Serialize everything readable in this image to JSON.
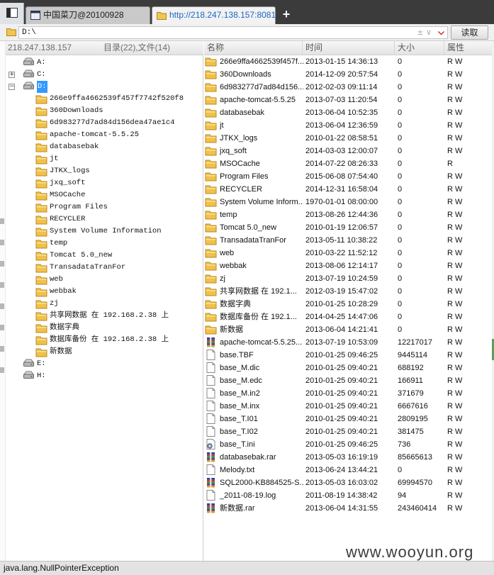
{
  "tabs": [
    {
      "title": "中国菜刀@20100928",
      "active": false
    },
    {
      "title": "http://218.247.138.157:8081...",
      "active": true
    }
  ],
  "newtab_symbol": "+",
  "path": {
    "value": "D:\\",
    "plusminus": "± ∨",
    "read_label": "读取"
  },
  "left": {
    "ip": "218.247.138.157",
    "counts": "目录(22),文件(14)",
    "drives_top": [
      {
        "label": "A:",
        "toggle": ""
      },
      {
        "label": "C:",
        "toggle": "+"
      },
      {
        "label": "D:",
        "toggle": "−",
        "selected": true
      }
    ],
    "tree_dirs": [
      "266e9ffa4662539f457f7742f520f8",
      "360Downloads",
      "6d983277d7ad84d156dea47ae1c4",
      "apache-tomcat-5.5.25",
      "databasebak",
      "jt",
      "JTKX_logs",
      "jxq_soft",
      "MSOCache",
      "Program Files",
      "RECYCLER",
      "System Volume Information",
      "temp",
      "Tomcat 5.0_new",
      "TransadataTranFor",
      "web",
      "webbak",
      "zj",
      "共享网数据 在 192.168.2.38 上",
      "数据字典",
      "数据库备份 在 192.168.2.38 上",
      "新数据"
    ],
    "drives_bottom": [
      {
        "label": "E:"
      },
      {
        "label": "H:"
      }
    ]
  },
  "list": {
    "headers": {
      "name": "名称",
      "time": "时间",
      "size": "大小",
      "attr": "属性"
    },
    "rows": [
      {
        "name": "266e9ffa4662539f457f...",
        "time": "2013-01-15 14:36:13",
        "size": "0",
        "attr": "R W",
        "icon": "folder-icon"
      },
      {
        "name": "360Downloads",
        "time": "2014-12-09 20:57:54",
        "size": "0",
        "attr": "R W",
        "icon": "folder-icon"
      },
      {
        "name": "6d983277d7ad84d156...",
        "time": "2012-02-03 09:11:14",
        "size": "0",
        "attr": "R W",
        "icon": "folder-icon"
      },
      {
        "name": "apache-tomcat-5.5.25",
        "time": "2013-07-03 11:20:54",
        "size": "0",
        "attr": "R W",
        "icon": "folder-icon"
      },
      {
        "name": "databasebak",
        "time": "2013-06-04 10:52:35",
        "size": "0",
        "attr": "R W",
        "icon": "folder-icon"
      },
      {
        "name": "jt",
        "time": "2013-06-04 12:36:59",
        "size": "0",
        "attr": "R W",
        "icon": "folder-icon"
      },
      {
        "name": "JTKX_logs",
        "time": "2010-01-22 08:58:51",
        "size": "0",
        "attr": "R W",
        "icon": "folder-icon"
      },
      {
        "name": "jxq_soft",
        "time": "2014-03-03 12:00:07",
        "size": "0",
        "attr": "R W",
        "icon": "folder-icon"
      },
      {
        "name": "MSOCache",
        "time": "2014-07-22 08:26:33",
        "size": "0",
        "attr": "R",
        "icon": "folder-icon"
      },
      {
        "name": "Program Files",
        "time": "2015-06-08 07:54:40",
        "size": "0",
        "attr": "R W",
        "icon": "folder-icon"
      },
      {
        "name": "RECYCLER",
        "time": "2014-12-31 16:58:04",
        "size": "0",
        "attr": "R W",
        "icon": "folder-icon"
      },
      {
        "name": "System Volume Inform...",
        "time": "1970-01-01 08:00:00",
        "size": "0",
        "attr": "R W",
        "icon": "folder-icon"
      },
      {
        "name": "temp",
        "time": "2013-08-26 12:44:36",
        "size": "0",
        "attr": "R W",
        "icon": "folder-icon"
      },
      {
        "name": "Tomcat 5.0_new",
        "time": "2010-01-19 12:06:57",
        "size": "0",
        "attr": "R W",
        "icon": "folder-icon"
      },
      {
        "name": "TransadataTranFor",
        "time": "2013-05-11 10:38:22",
        "size": "0",
        "attr": "R W",
        "icon": "folder-icon"
      },
      {
        "name": "web",
        "time": "2010-03-22 11:52:12",
        "size": "0",
        "attr": "R W",
        "icon": "folder-icon"
      },
      {
        "name": "webbak",
        "time": "2013-08-06 12:14:17",
        "size": "0",
        "attr": "R W",
        "icon": "folder-icon"
      },
      {
        "name": "zj",
        "time": "2013-07-19 10:24:59",
        "size": "0",
        "attr": "R W",
        "icon": "folder-icon"
      },
      {
        "name": "共享网数据 在 192.1...",
        "time": "2012-03-19 15:47:02",
        "size": "0",
        "attr": "R W",
        "icon": "folder-icon"
      },
      {
        "name": "数据字典",
        "time": "2010-01-25 10:28:29",
        "size": "0",
        "attr": "R W",
        "icon": "folder-icon"
      },
      {
        "name": "数据库备份 在 192.1...",
        "time": "2014-04-25 14:47:06",
        "size": "0",
        "attr": "R W",
        "icon": "folder-icon"
      },
      {
        "name": "新数据",
        "time": "2013-06-04 14:21:41",
        "size": "0",
        "attr": "R W",
        "icon": "folder-icon"
      },
      {
        "name": "apache-tomcat-5.5.25...",
        "time": "2013-07-19 10:53:09",
        "size": "12217017",
        "attr": "R W",
        "icon": "archive-icon"
      },
      {
        "name": "base.TBF",
        "time": "2010-01-25 09:46:25",
        "size": "9445114",
        "attr": "R W",
        "icon": "file-icon"
      },
      {
        "name": "base_M.dic",
        "time": "2010-01-25 09:40:21",
        "size": "688192",
        "attr": "R W",
        "icon": "file-icon"
      },
      {
        "name": "base_M.edc",
        "time": "2010-01-25 09:40:21",
        "size": "166911",
        "attr": "R W",
        "icon": "file-icon"
      },
      {
        "name": "base_M.in2",
        "time": "2010-01-25 09:40:21",
        "size": "371679",
        "attr": "R W",
        "icon": "file-icon"
      },
      {
        "name": "base_M.inx",
        "time": "2010-01-25 09:40:21",
        "size": "6667616",
        "attr": "R W",
        "icon": "file-icon"
      },
      {
        "name": "base_T.I01",
        "time": "2010-01-25 09:40:21",
        "size": "2809195",
        "attr": "R W",
        "icon": "file-icon"
      },
      {
        "name": "base_T.I02",
        "time": "2010-01-25 09:40:21",
        "size": "381475",
        "attr": "R W",
        "icon": "file-icon"
      },
      {
        "name": "base_T.ini",
        "time": "2010-01-25 09:46:25",
        "size": "736",
        "attr": "R W",
        "icon": "settings-file-icon"
      },
      {
        "name": "databasebak.rar",
        "time": "2013-05-03 16:19:19",
        "size": "85665613",
        "attr": "R W",
        "icon": "archive-icon"
      },
      {
        "name": "Melody.txt",
        "time": "2013-06-24 13:44:21",
        "size": "0",
        "attr": "R W",
        "icon": "file-icon"
      },
      {
        "name": "SQL2000-KB884525-S...",
        "time": "2013-05-03 16:03:02",
        "size": "69994570",
        "attr": "R W",
        "icon": "archive-icon"
      },
      {
        "name": "_2011-08-19.log",
        "time": "2011-08-19 14:38:42",
        "size": "94",
        "attr": "R W",
        "icon": "file-icon"
      },
      {
        "name": "新数据.rar",
        "time": "2013-06-04 14:31:55",
        "size": "243460414",
        "attr": "R W",
        "icon": "archive-icon"
      }
    ]
  },
  "status": "java.lang.NullPointerException",
  "watermark": "www.wooyun.org",
  "colors": {
    "selection": "#3399ff",
    "folder": "#e8b73c",
    "active_tab_text": "#1d64c8",
    "tabbar_bg": "#3b3b3b"
  }
}
